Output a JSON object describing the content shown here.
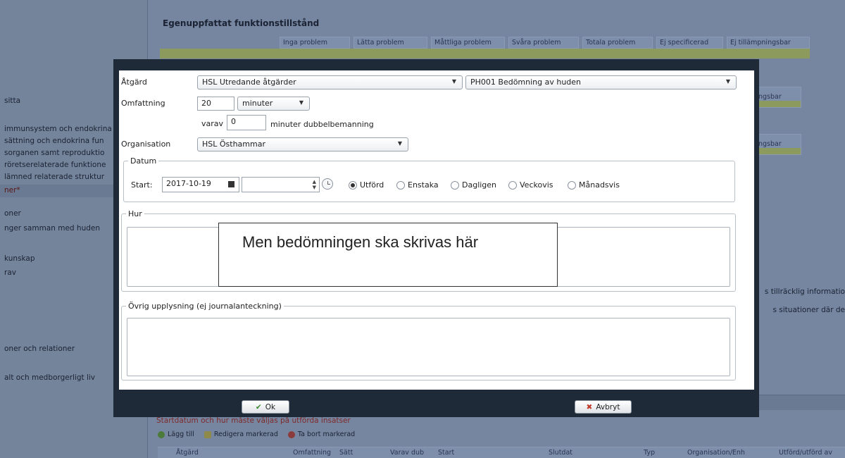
{
  "background": {
    "section_title": "Egenuppfattat funktionstillstånd",
    "grid_headers": [
      "Inga problem",
      "Lätta problem",
      "Måttliga problem",
      "Svåra problem",
      "Totala problem",
      "Ej specificerad",
      "Ej tillämpningsbar"
    ],
    "sidebar_items": [
      "sitta",
      "immunsystem och endokrina",
      "sättning och endokrina fun",
      "sorganen samt reproduktio",
      "röretserelaterade funktione",
      "lämned relaterade struktur",
      "ner*",
      "oner",
      "nger samman med huden",
      "kunskap",
      "rav",
      "oner och relationer",
      "alt och medborgerligt liv"
    ],
    "right_texts": [
      "s tillräcklig informatio",
      "s situationer där de"
    ],
    "chip_label": "ngsbar",
    "instruction_text": "Startdatum och hur måste väljas på utförda insatser",
    "toolbar": {
      "add": "Lägg till",
      "edit": "Redigera markerad",
      "delete": "Ta bort markerad"
    },
    "column_headers": [
      "Åtgärd",
      "Omfattning",
      "Sätt",
      "Varav dub",
      "Start",
      "Slutdat",
      "Typ",
      "Organisation/Enh",
      "Utförd/utförd av"
    ]
  },
  "form": {
    "atgard_label": "Åtgärd",
    "atgard_value": "HSL Utredande åtgärder",
    "atgard_sub_value": "PH001 Bedömning av huden",
    "omfattning_label": "Omfattning",
    "omfattning_value": "20",
    "unit_value": "minuter",
    "varav_label": "varav",
    "varav_value": "0",
    "dubbel_label": "minuter dubbelbemanning",
    "org_label": "Organisation",
    "org_value": "HSL Östhammar",
    "datum_legend": "Datum",
    "start_label": "Start:",
    "start_date": "2017-10-19",
    "start_time": "",
    "frequency": [
      {
        "label": "Utförd",
        "selected": true
      },
      {
        "label": "Enstaka",
        "selected": false
      },
      {
        "label": "Dagligen",
        "selected": false
      },
      {
        "label": "Veckovis",
        "selected": false
      },
      {
        "label": "Månadsvis",
        "selected": false
      }
    ],
    "hur_legend": "Hur",
    "hur_value": "",
    "ovrig_legend": "Övrig upplysning (ej journalanteckning)",
    "ovrig_value": ""
  },
  "callout_text": "Men bedömningen ska skrivas här",
  "buttons": {
    "ok": "Ok",
    "cancel": "Avbryt"
  }
}
